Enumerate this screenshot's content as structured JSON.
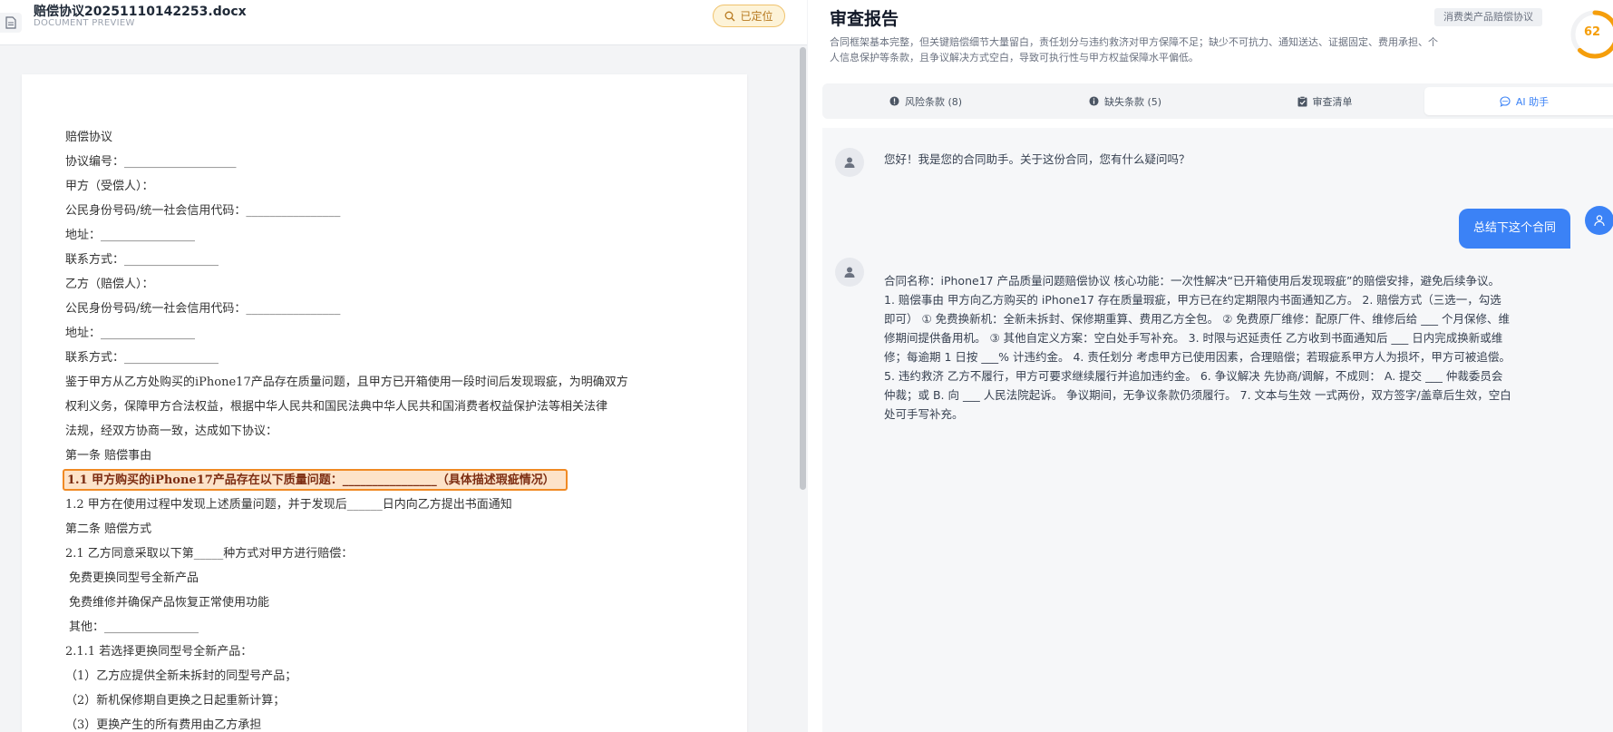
{
  "document": {
    "file_name": "赔偿协议20251110142253.docx",
    "subtitle": "DOCUMENT PREVIEW",
    "locate_label": "已定位",
    "lines": [
      "赔偿协议",
      "协议编号：___________________",
      "甲方（受偿人）：",
      "公民身份号码/统一社会信用代码：________________",
      "地址：________________",
      "联系方式：________________",
      "乙方（赔偿人）：",
      "公民身份号码/统一社会信用代码：________________",
      "地址：________________",
      "联系方式：________________",
      "鉴于甲方从乙方处购买的iPhone17产品存在质量问题，且甲方已开箱使用一段时间后发现瑕疵，为明确双方",
      "权利义务，保障甲方合法权益，根据中华人民共和国民法典中华人民共和国消费者权益保护法等相关法律",
      "法规，经双方协商一致，达成如下协议：",
      "第一条 赔偿事由",
      "1.1 甲方购买的iPhone17产品存在以下质量问题：________________（具体描述瑕疵情况）",
      "1.2 甲方在使用过程中发现上述质量问题，并于发现后______日内向乙方提出书面通知",
      "第二条 赔偿方式",
      "2.1 乙方同意采取以下第_____种方式对甲方进行赔偿：",
      " 免费更换同型号全新产品",
      " 免费维修并确保产品恢复正常使用功能",
      " 其他：________________",
      "2.1.1 若选择更换同型号全新产品：",
      "（1）乙方应提供全新未拆封的同型号产品；",
      "（2）新机保修期自更换之日起重新计算；",
      "（3）更换产生的所有费用由乙方承担"
    ],
    "highlight_index": 14
  },
  "report": {
    "title": "审查报告",
    "category": "消费类产品赔偿协议",
    "score": "62",
    "score_fraction": 0.62,
    "summary": "合同框架基本完整，但关键赔偿细节大量留白，责任划分与违约救济对甲方保障不足；缺少不可抗力、通知送达、证据固定、费用承担、个人信息保护等条款，且争议解决方式空白，导致可执行性与甲方权益保障水平偏低。",
    "tabs": [
      {
        "label": "风险条款 (8)",
        "icon": "alert-circle-icon"
      },
      {
        "label": "缺失条款 (5)",
        "icon": "info-circle-icon"
      },
      {
        "label": "审查清单",
        "icon": "clipboard-check-icon"
      },
      {
        "label": "AI 助手",
        "icon": "chat-bubble-icon"
      }
    ],
    "active_tab": 3
  },
  "chat": {
    "greeting": "您好！我是您的合同助手。关于这份合同，您有什么疑问吗？",
    "user_message": "总结下这个合同",
    "answer": "合同名称：iPhone17 产品质量问题赔偿协议 核心功能：一次性解决“已开箱使用后发现瑕疵”的赔偿安排，避免后续争议。 1. 赔偿事由 甲方向乙方购买的 iPhone17 存在质量瑕疵，甲方已在约定期限内书面通知乙方。 2. 赔偿方式（三选一，勾选即可） ① 免费换新机：全新未拆封、保修期重算、费用乙方全包。 ② 免费原厂维修：配原厂件、维修后给 ___ 个月保修、维修期间提供备用机。 ③ 其他自定义方案：空白处手写补充。 3. 时限与迟延责任 乙方收到书面通知后 ___ 日内完成换新或维修；每逾期 1 日按 ___% 计违约金。 4. 责任划分 考虑甲方已使用因素，合理赔偿；若瑕疵系甲方人为损坏，甲方可被追偿。 5. 违约救济 乙方不履行，甲方可要求继续履行并追加违约金。 6. 争议解决 先协商/调解，不成则： A. 提交 ___ 仲裁委员会仲裁；或 B. 向 ___ 人民法院起诉。 争议期间，无争议条款仍须履行。 7. 文本与生效 一式两份，双方签字/盖章后生效，空白处可手写补充。"
  },
  "colors": {
    "accent": "#3b82f6",
    "highlight_border": "#f08a24",
    "highlight_fill": "#fde3c9",
    "score": "#f59e0b",
    "locate_badge": "#fdf3d8"
  }
}
